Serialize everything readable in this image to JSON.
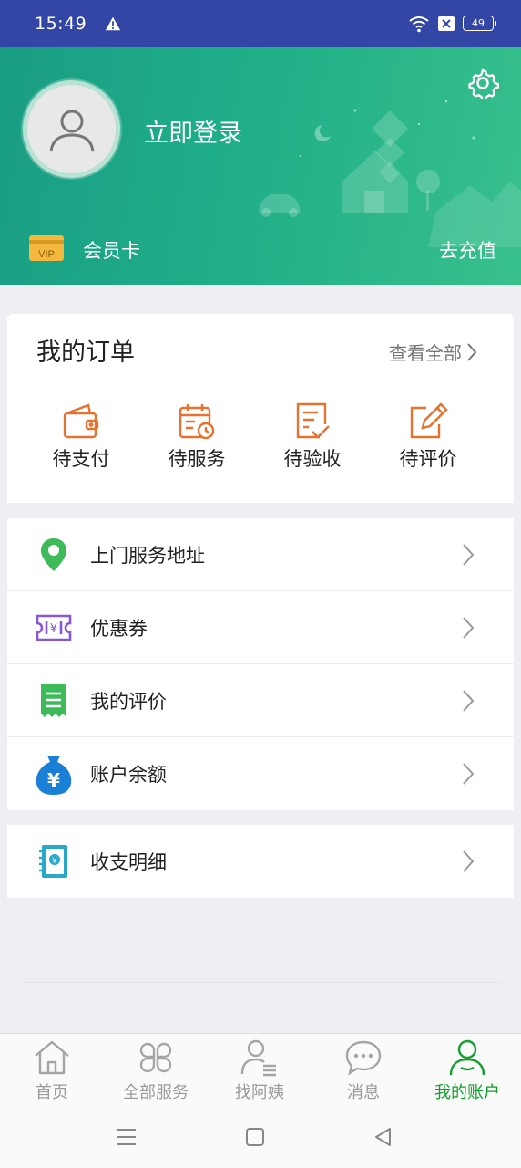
{
  "status_bar": {
    "time": "15:49",
    "battery": "49"
  },
  "header": {
    "login_text": "立即登录",
    "member_card": "会员卡",
    "recharge": "去充值"
  },
  "orders": {
    "title": "我的订单",
    "view_all": "查看全部",
    "items": [
      {
        "label": "待支付",
        "icon": "wallet-icon"
      },
      {
        "label": "待服务",
        "icon": "calendar-clock-icon"
      },
      {
        "label": "待验收",
        "icon": "checklist-icon"
      },
      {
        "label": "待评价",
        "icon": "edit-icon"
      }
    ]
  },
  "menu": {
    "items": [
      {
        "label": "上门服务地址",
        "icon": "location-pin-icon"
      },
      {
        "label": "优惠券",
        "icon": "coupon-icon"
      },
      {
        "label": "我的评价",
        "icon": "receipt-icon"
      },
      {
        "label": "账户余额",
        "icon": "money-bag-icon"
      }
    ],
    "extra": [
      {
        "label": "收支明细",
        "icon": "ledger-icon"
      }
    ]
  },
  "tabbar": {
    "items": [
      {
        "label": "首页",
        "icon": "home-icon"
      },
      {
        "label": "全部服务",
        "icon": "grid-icon"
      },
      {
        "label": "找阿姨",
        "icon": "person-list-icon"
      },
      {
        "label": "消息",
        "icon": "chat-bubble-icon"
      },
      {
        "label": "我的账户",
        "icon": "user-icon",
        "active": true
      }
    ]
  },
  "colors": {
    "status_bar": "#3346a6",
    "header_green": "#1fae88",
    "order_icon": "#e8712d",
    "active_tab": "#12a02c"
  }
}
